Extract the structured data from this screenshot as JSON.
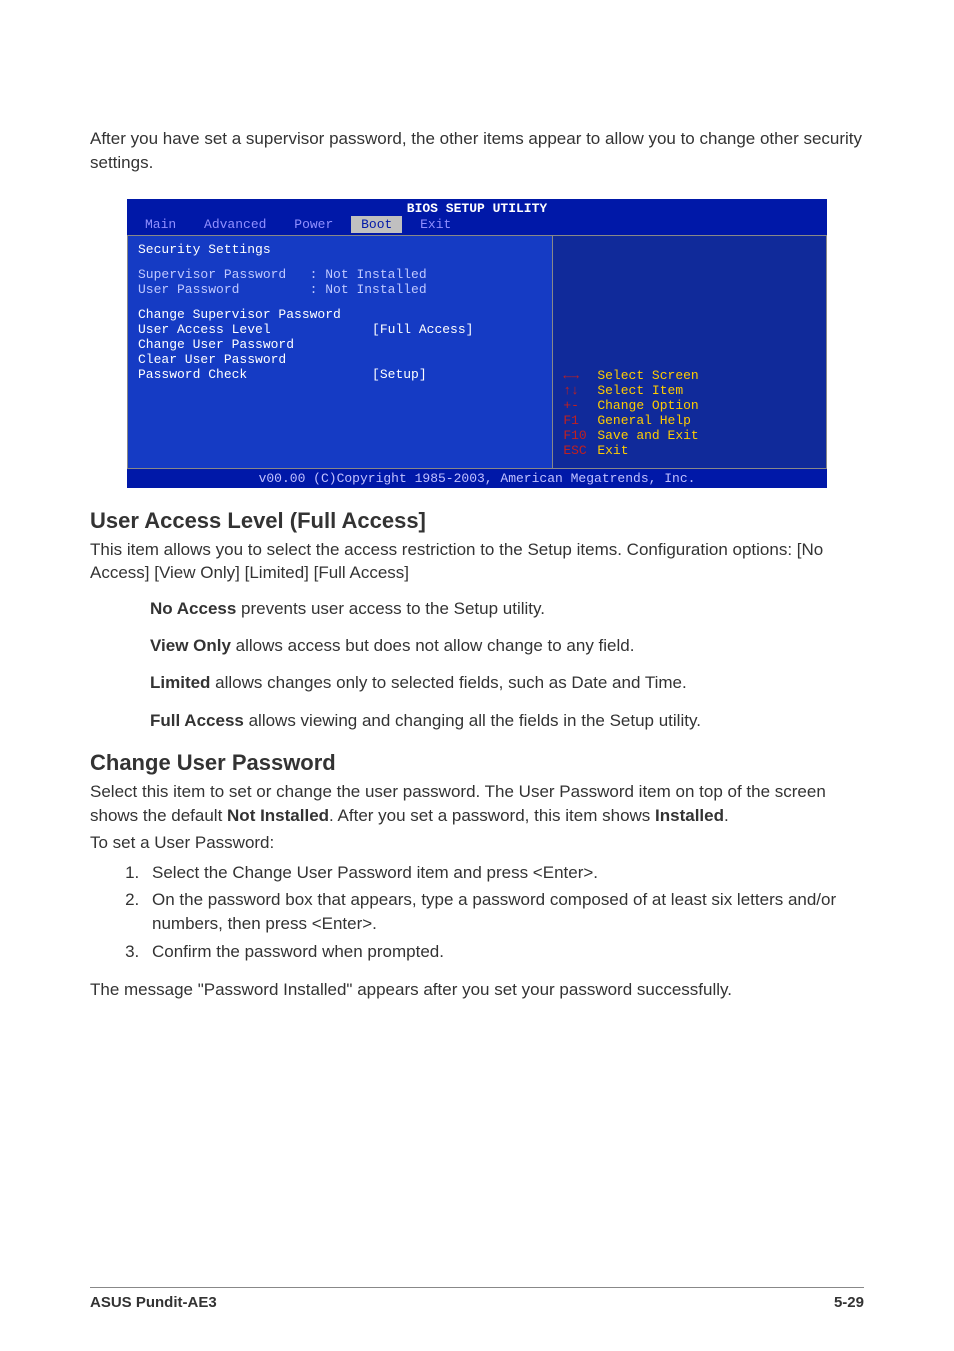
{
  "intro": "After you have set a supervisor password, the other items appear to allow you to change other security settings.",
  "bios": {
    "utility_title": "BIOS SETUP UTILITY",
    "tabs": [
      "Main",
      "Advanced",
      "Power",
      "Boot",
      "Exit"
    ],
    "active_tab": "Boot",
    "section_title": "Security Settings",
    "status_rows": [
      {
        "label": "Supervisor Password",
        "value": ": Not Installed"
      },
      {
        "label": "User Password",
        "value": ": Not Installed"
      }
    ],
    "menu_rows": [
      {
        "label": "Change Supervisor Password",
        "value": ""
      },
      {
        "label": "User Access Level",
        "value": "[Full Access]"
      },
      {
        "label": "Change User Password",
        "value": ""
      },
      {
        "label": "Clear User Password",
        "value": ""
      },
      {
        "label": "Password Check",
        "value": "[Setup]"
      }
    ],
    "help": [
      {
        "key": "←→",
        "text": "Select Screen"
      },
      {
        "key": "↑↓",
        "text": "Select Item"
      },
      {
        "key": "+-",
        "text": "Change Option"
      },
      {
        "key": "F1",
        "text": "General Help"
      },
      {
        "key": "F10",
        "text": "Save and Exit"
      },
      {
        "key": "ESC",
        "text": "Exit"
      }
    ],
    "copyright": "v00.00 (C)Copyright 1985-2003, American Megatrends, Inc."
  },
  "ual": {
    "heading": "User Access Level (Full Access]",
    "desc": "This item allows you to select the access restriction to the Setup items. Configuration options: [No Access] [View Only] [Limited] [Full Access]",
    "opts": {
      "no_access_b": "No Access",
      "no_access_t": " prevents user access to the Setup utility.",
      "view_only_b": "View Only",
      "view_only_t": " allows access but does not allow change to any field.",
      "limited_b": "Limited",
      "limited_t": " allows changes only to selected fields, such as Date and Time.",
      "full_access_b": "Full Access",
      "full_access_t": " allows viewing and changing all the fields in the Setup utility."
    }
  },
  "cup": {
    "heading": "Change User Password",
    "p1a": "Select this item to set or change the user password. The User Password item on top of the screen shows the default ",
    "p1b": "Not Installed",
    "p1c": ". After you set a password, this item shows ",
    "p1d": "Installed",
    "p1e": ".",
    "p2": "To set a User Password:",
    "steps": [
      "Select the Change User Password item and press <Enter>.",
      "On the password box that appears, type a password composed of at least six letters and/or numbers, then press <Enter>.",
      "Confirm the password when prompted."
    ],
    "p3": "The message \"Password Installed\" appears after you set your password successfully."
  },
  "footer": {
    "left": "ASUS Pundit-AE3",
    "right": "5-29"
  }
}
